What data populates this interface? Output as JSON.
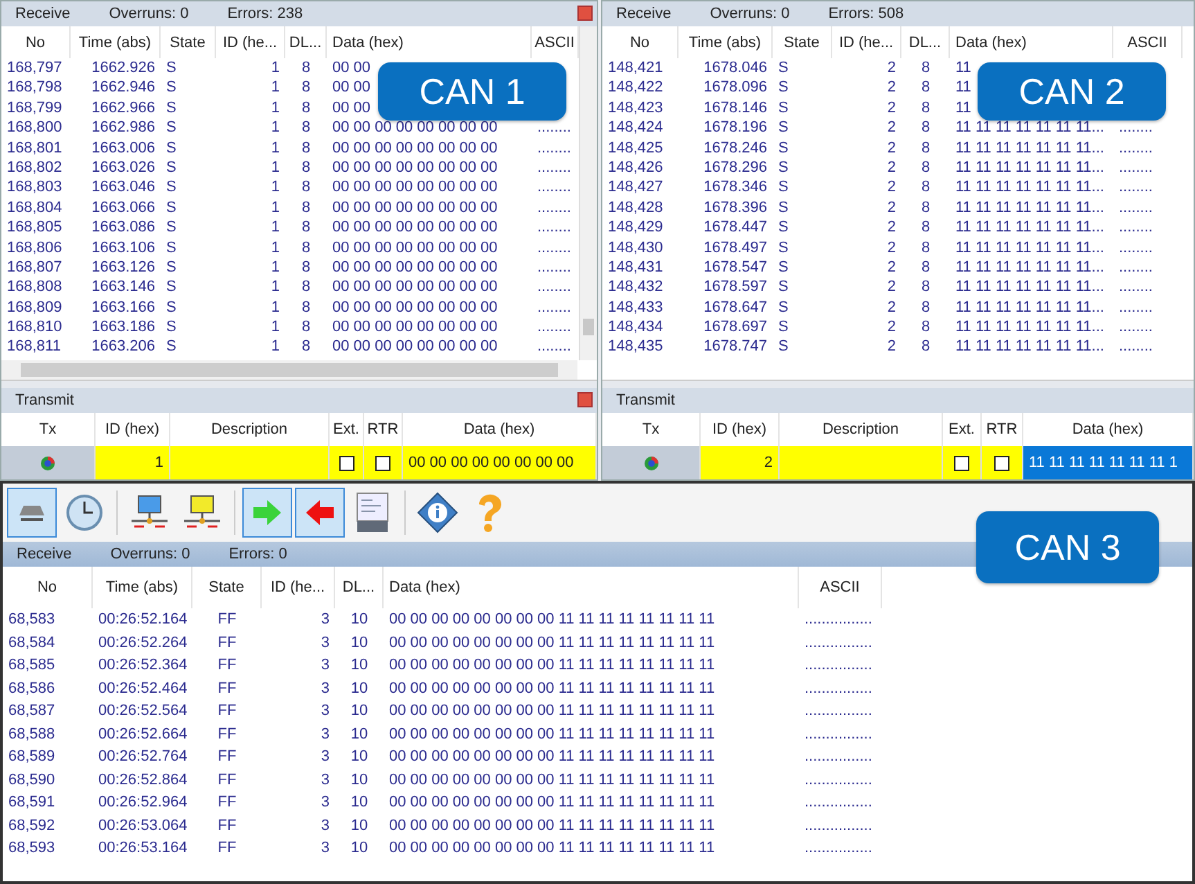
{
  "panels": [
    {
      "receive": {
        "label": "Receive",
        "overruns": "Overruns: 0",
        "errors": "Errors: 238"
      },
      "closable": true,
      "scrollbars": true,
      "badge": "CAN 1",
      "columns": [
        "No",
        "Time (abs)",
        "State",
        "ID (he...",
        "DL...",
        "Data (hex)",
        "ASCII"
      ],
      "rows": [
        {
          "no": "168,797",
          "time": "1662.926",
          "state": "S",
          "id": "1",
          "dlc": "8",
          "data": "00 00"
        },
        {
          "no": "168,798",
          "time": "1662.946",
          "state": "S",
          "id": "1",
          "dlc": "8",
          "data": "00 00"
        },
        {
          "no": "168,799",
          "time": "1662.966",
          "state": "S",
          "id": "1",
          "dlc": "8",
          "data": "00 00"
        },
        {
          "no": "168,800",
          "time": "1662.986",
          "state": "S",
          "id": "1",
          "dlc": "8",
          "data": "00 00 00 00 00 00 00 00",
          "ascii": "........"
        },
        {
          "no": "168,801",
          "time": "1663.006",
          "state": "S",
          "id": "1",
          "dlc": "8",
          "data": "00 00 00 00 00 00 00 00",
          "ascii": "........"
        },
        {
          "no": "168,802",
          "time": "1663.026",
          "state": "S",
          "id": "1",
          "dlc": "8",
          "data": "00 00 00 00 00 00 00 00",
          "ascii": "........"
        },
        {
          "no": "168,803",
          "time": "1663.046",
          "state": "S",
          "id": "1",
          "dlc": "8",
          "data": "00 00 00 00 00 00 00 00",
          "ascii": "........"
        },
        {
          "no": "168,804",
          "time": "1663.066",
          "state": "S",
          "id": "1",
          "dlc": "8",
          "data": "00 00 00 00 00 00 00 00",
          "ascii": "........"
        },
        {
          "no": "168,805",
          "time": "1663.086",
          "state": "S",
          "id": "1",
          "dlc": "8",
          "data": "00 00 00 00 00 00 00 00",
          "ascii": "........"
        },
        {
          "no": "168,806",
          "time": "1663.106",
          "state": "S",
          "id": "1",
          "dlc": "8",
          "data": "00 00 00 00 00 00 00 00",
          "ascii": "........"
        },
        {
          "no": "168,807",
          "time": "1663.126",
          "state": "S",
          "id": "1",
          "dlc": "8",
          "data": "00 00 00 00 00 00 00 00",
          "ascii": "........"
        },
        {
          "no": "168,808",
          "time": "1663.146",
          "state": "S",
          "id": "1",
          "dlc": "8",
          "data": "00 00 00 00 00 00 00 00",
          "ascii": "........"
        },
        {
          "no": "168,809",
          "time": "1663.166",
          "state": "S",
          "id": "1",
          "dlc": "8",
          "data": "00 00 00 00 00 00 00 00",
          "ascii": "........"
        },
        {
          "no": "168,810",
          "time": "1663.186",
          "state": "S",
          "id": "1",
          "dlc": "8",
          "data": "00 00 00 00 00 00 00 00",
          "ascii": "........"
        },
        {
          "no": "168,811",
          "time": "1663.206",
          "state": "S",
          "id": "1",
          "dlc": "8",
          "data": "00 00 00 00 00 00 00 00",
          "ascii": "........"
        }
      ],
      "transmit": {
        "label": "Transmit",
        "columns": [
          "Tx",
          "ID (hex)",
          "Description",
          "Ext.",
          "RTR",
          "Data (hex)"
        ],
        "row": {
          "id": "1",
          "ext": false,
          "rtr": false,
          "data": "00 00 00 00 00 00 00 00",
          "data_selected": false
        }
      }
    },
    {
      "receive": {
        "label": "Receive",
        "overruns": "Overruns: 0",
        "errors": "Errors: 508"
      },
      "closable": false,
      "scrollbars": false,
      "badge": "CAN 2",
      "columns": [
        "No",
        "Time (abs)",
        "State",
        "ID (he...",
        "DL...",
        "Data (hex)",
        "ASCII"
      ],
      "rows": [
        {
          "no": "148,421",
          "time": "1678.046",
          "state": "S",
          "id": "2",
          "dlc": "8",
          "data": "11"
        },
        {
          "no": "148,422",
          "time": "1678.096",
          "state": "S",
          "id": "2",
          "dlc": "8",
          "data": "11"
        },
        {
          "no": "148,423",
          "time": "1678.146",
          "state": "S",
          "id": "2",
          "dlc": "8",
          "data": "11"
        },
        {
          "no": "148,424",
          "time": "1678.196",
          "state": "S",
          "id": "2",
          "dlc": "8",
          "data": "11 11 11 11 11 11 11...",
          "ascii": "........"
        },
        {
          "no": "148,425",
          "time": "1678.246",
          "state": "S",
          "id": "2",
          "dlc": "8",
          "data": "11 11 11 11 11 11 11...",
          "ascii": "........"
        },
        {
          "no": "148,426",
          "time": "1678.296",
          "state": "S",
          "id": "2",
          "dlc": "8",
          "data": "11 11 11 11 11 11 11...",
          "ascii": "........"
        },
        {
          "no": "148,427",
          "time": "1678.346",
          "state": "S",
          "id": "2",
          "dlc": "8",
          "data": "11 11 11 11 11 11 11...",
          "ascii": "........"
        },
        {
          "no": "148,428",
          "time": "1678.396",
          "state": "S",
          "id": "2",
          "dlc": "8",
          "data": "11 11 11 11 11 11 11...",
          "ascii": "........"
        },
        {
          "no": "148,429",
          "time": "1678.447",
          "state": "S",
          "id": "2",
          "dlc": "8",
          "data": "11 11 11 11 11 11 11...",
          "ascii": "........"
        },
        {
          "no": "148,430",
          "time": "1678.497",
          "state": "S",
          "id": "2",
          "dlc": "8",
          "data": "11 11 11 11 11 11 11...",
          "ascii": "........"
        },
        {
          "no": "148,431",
          "time": "1678.547",
          "state": "S",
          "id": "2",
          "dlc": "8",
          "data": "11 11 11 11 11 11 11...",
          "ascii": "........"
        },
        {
          "no": "148,432",
          "time": "1678.597",
          "state": "S",
          "id": "2",
          "dlc": "8",
          "data": "11 11 11 11 11 11 11...",
          "ascii": "........"
        },
        {
          "no": "148,433",
          "time": "1678.647",
          "state": "S",
          "id": "2",
          "dlc": "8",
          "data": "11 11 11 11 11 11 11...",
          "ascii": "........"
        },
        {
          "no": "148,434",
          "time": "1678.697",
          "state": "S",
          "id": "2",
          "dlc": "8",
          "data": "11 11 11 11 11 11 11...",
          "ascii": "........"
        },
        {
          "no": "148,435",
          "time": "1678.747",
          "state": "S",
          "id": "2",
          "dlc": "8",
          "data": "11 11 11 11 11 11 11...",
          "ascii": "........"
        }
      ],
      "transmit": {
        "label": "Transmit",
        "columns": [
          "Tx",
          "ID (hex)",
          "Description",
          "Ext.",
          "RTR",
          "Data (hex)"
        ],
        "row": {
          "id": "2",
          "ext": false,
          "rtr": false,
          "data": "11 11 11 11 11 11 11 1",
          "data_selected": true
        }
      }
    }
  ],
  "bottom": {
    "badge": "CAN 3",
    "toolbar": [
      {
        "kind": "eject",
        "selected": true
      },
      {
        "kind": "clock",
        "selected": false
      },
      {
        "kind": "net-blue",
        "selected": false
      },
      {
        "kind": "net-yellow",
        "selected": false
      },
      {
        "kind": "arrow-right",
        "selected": true
      },
      {
        "kind": "arrow-left",
        "selected": true
      },
      {
        "kind": "log",
        "selected": false
      },
      {
        "kind": "info",
        "selected": false
      },
      {
        "kind": "help",
        "selected": false
      }
    ],
    "receive": {
      "label": "Receive",
      "overruns": "Overruns: 0",
      "errors": "Errors: 0"
    },
    "columns": [
      "No",
      "Time (abs)",
      "State",
      "ID (he...",
      "DL...",
      "Data (hex)",
      "ASCII"
    ],
    "rows": [
      {
        "no": "68,583",
        "time": "00:26:52.164",
        "state": "FF",
        "id": "3",
        "dlc": "10",
        "data": "00 00 00 00 00 00 00 00 11 11 11 11 11 11 11 11",
        "ascii": "................"
      },
      {
        "no": "68,584",
        "time": "00:26:52.264",
        "state": "FF",
        "id": "3",
        "dlc": "10",
        "data": "00 00 00 00 00 00 00 00 11 11 11 11 11 11 11 11",
        "ascii": "................"
      },
      {
        "no": "68,585",
        "time": "00:26:52.364",
        "state": "FF",
        "id": "3",
        "dlc": "10",
        "data": "00 00 00 00 00 00 00 00 11 11 11 11 11 11 11 11",
        "ascii": "................"
      },
      {
        "no": "68,586",
        "time": "00:26:52.464",
        "state": "FF",
        "id": "3",
        "dlc": "10",
        "data": "00 00 00 00 00 00 00 00 11 11 11 11 11 11 11 11",
        "ascii": "................"
      },
      {
        "no": "68,587",
        "time": "00:26:52.564",
        "state": "FF",
        "id": "3",
        "dlc": "10",
        "data": "00 00 00 00 00 00 00 00 11 11 11 11 11 11 11 11",
        "ascii": "................"
      },
      {
        "no": "68,588",
        "time": "00:26:52.664",
        "state": "FF",
        "id": "3",
        "dlc": "10",
        "data": "00 00 00 00 00 00 00 00 11 11 11 11 11 11 11 11",
        "ascii": "................"
      },
      {
        "no": "68,589",
        "time": "00:26:52.764",
        "state": "FF",
        "id": "3",
        "dlc": "10",
        "data": "00 00 00 00 00 00 00 00 11 11 11 11 11 11 11 11",
        "ascii": "................"
      },
      {
        "no": "68,590",
        "time": "00:26:52.864",
        "state": "FF",
        "id": "3",
        "dlc": "10",
        "data": "00 00 00 00 00 00 00 00 11 11 11 11 11 11 11 11",
        "ascii": "................"
      },
      {
        "no": "68,591",
        "time": "00:26:52.964",
        "state": "FF",
        "id": "3",
        "dlc": "10",
        "data": "00 00 00 00 00 00 00 00 11 11 11 11 11 11 11 11",
        "ascii": "................"
      },
      {
        "no": "68,592",
        "time": "00:26:53.064",
        "state": "FF",
        "id": "3",
        "dlc": "10",
        "data": "00 00 00 00 00 00 00 00 11 11 11 11 11 11 11 11",
        "ascii": "................"
      },
      {
        "no": "68,593",
        "time": "00:26:53.164",
        "state": "FF",
        "id": "3",
        "dlc": "10",
        "data": "00 00 00 00 00 00 00 00 11 11 11 11 11 11 11 11",
        "ascii": "................"
      }
    ]
  }
}
